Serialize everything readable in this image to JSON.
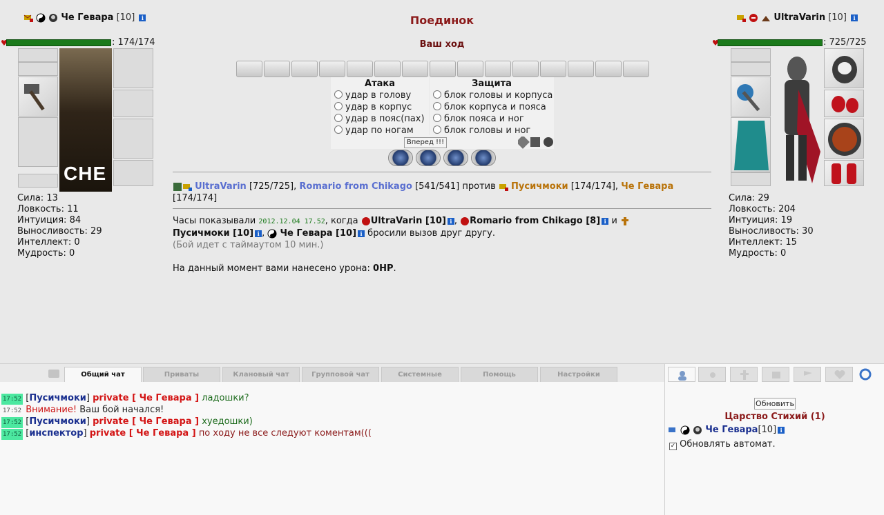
{
  "battle": {
    "title": "Поединок",
    "turn_status": "Ваш ход"
  },
  "left_player": {
    "name": "Че Гевара",
    "level": "[10]",
    "hp_text": ": 174/174",
    "hp_fraction": 1.0,
    "portrait_caption": "CHE",
    "stats": [
      "Сила: 13",
      "Ловкость: 11",
      "Интуиция: 84",
      "Выносливость: 29",
      "Интеллект: 0",
      "Мудрость: 0"
    ]
  },
  "right_player": {
    "name": "UltraVarin",
    "level": "[10]",
    "hp_text": ": 725/725",
    "hp_fraction": 1.0,
    "stats": [
      "Сила: 29",
      "Ловкость: 204",
      "Интуиция: 19",
      "Выносливость: 30",
      "Интеллект: 15",
      "Мудрость: 0"
    ]
  },
  "attack": {
    "header": "Атака",
    "options": [
      "удар в голову",
      "удар в корпус",
      "удар в пояс(пах)",
      "удар по ногам"
    ]
  },
  "defense": {
    "header": "Защита",
    "options": [
      "блок головы и корпуса",
      "блок корпуса и пояса",
      "блок пояса и ног",
      "блок головы и ног"
    ]
  },
  "forward_button": "Вперед !!!",
  "teams": {
    "team1_p1": "UltraVarin",
    "team1_p1_hp": "[725/725],",
    "team1_p2": "Romario from Chikago",
    "team1_p2_hp": "[541/541]",
    "versus": "против",
    "team2_p1": "Пусичмоки",
    "team2_p1_hp": "[174/174],",
    "team2_p2": "Че Гевара",
    "team2_p2_hp": "[174/174]"
  },
  "log": {
    "clock_prefix": "Часы показывали",
    "timestamp": "2012.12.04 17.52",
    "when": ", когда",
    "p1": "UltraVarin [10]",
    "p2": "Romario from Chikago [8]",
    "and": "и",
    "p3": "Пусичмоки [10]",
    "p4": "Че Гевара [10]",
    "challenged": "бросили вызов друг другу.",
    "timeout_note": "(Бой идет с таймаутом 10 мин.)",
    "damage_prefix": "На данный момент вами нанесено урона:",
    "damage_value": "0HP",
    "damage_suffix": "."
  },
  "chat_tabs": [
    "Общий чат",
    "Приваты",
    "Клановый чат",
    "Групповой чат",
    "Системные",
    "Помощь",
    "Настройки"
  ],
  "chat_messages": [
    {
      "time": "17:52",
      "highlight": true,
      "nick": "Пусичмоки",
      "private": "private [ Че Гевара ]",
      "text": "ладошки?"
    },
    {
      "time": "17:52",
      "highlight": false,
      "warn": "Внимание!",
      "text": "Ваш бой начался!"
    },
    {
      "time": "17:52",
      "highlight": true,
      "nick": "Пусичмоки",
      "private": "private [ Че Гевара ]",
      "text": "хуедошки)"
    },
    {
      "time": "17:52",
      "highlight": true,
      "nick": "инспектор",
      "private": "private [ Че Гевара ]",
      "text": "по ходу не все следуют коментам((("
    }
  ],
  "side": {
    "refresh_button": "Обновить",
    "room_name": "Царство Стихий (1)",
    "user_name": "Че Гевара",
    "user_level": "[10]",
    "auto_refresh_label": "Обновлять автомат."
  },
  "colors": {
    "title": "#8b1a1a",
    "hp_bar": "#1b7a1b",
    "team1_link": "#5a6fd0",
    "team2_link": "#b9730a",
    "private": "#d31414",
    "time_highlight": "#4ce8a0"
  }
}
